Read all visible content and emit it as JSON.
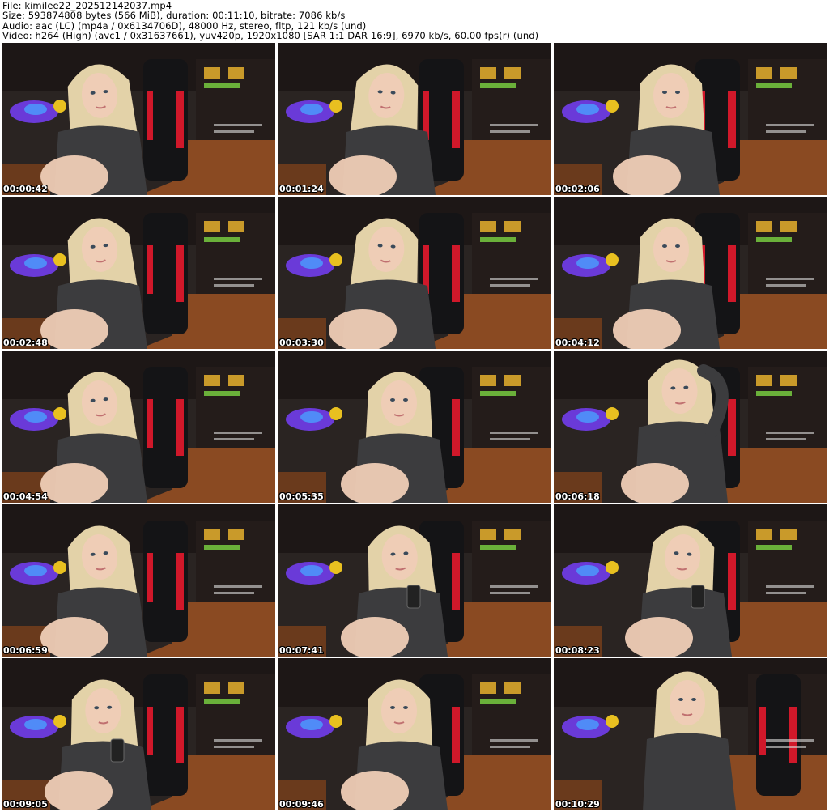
{
  "header": {
    "file_line": "File: kimilee22_202512142037.mp4",
    "size_line": "Size: 593874808 bytes (566 MiB), duration: 00:11:10, bitrate: 7086 kb/s",
    "audio_line": "Audio: aac (LC) (mp4a / 0x6134706D), 48000 Hz, stereo, fltp, 121 kb/s (und)",
    "video_line": "Video: h264 (High) (avc1 / 0x31637661), yuv420p, 1920x1080 [SAR 1:1 DAR 16:9], 6970 kb/s, 60.00 fps(r) (und)"
  },
  "thumbnails": [
    {
      "timestamp": "00:00:42",
      "pose": "left"
    },
    {
      "timestamp": "00:01:24",
      "pose": "side"
    },
    {
      "timestamp": "00:02:06",
      "pose": "right"
    },
    {
      "timestamp": "00:02:48",
      "pose": "left"
    },
    {
      "timestamp": "00:03:30",
      "pose": "side"
    },
    {
      "timestamp": "00:04:12",
      "pose": "right"
    },
    {
      "timestamp": "00:04:54",
      "pose": "left"
    },
    {
      "timestamp": "00:05:35",
      "pose": "center"
    },
    {
      "timestamp": "00:06:18",
      "pose": "arm"
    },
    {
      "timestamp": "00:06:59",
      "pose": "left"
    },
    {
      "timestamp": "00:07:41",
      "pose": "phone"
    },
    {
      "timestamp": "00:08:23",
      "pose": "phone-right"
    },
    {
      "timestamp": "00:09:05",
      "pose": "phone-left"
    },
    {
      "timestamp": "00:09:46",
      "pose": "center"
    },
    {
      "timestamp": "00:10:29",
      "pose": "standing"
    }
  ],
  "colors": {
    "hair": "#e3d2a8",
    "skin": "#efcdb6",
    "sweater": "#3c3c3e",
    "floor": "#8a4a22",
    "wall": "#2a2422",
    "chair_red": "#d0182a",
    "chair_black": "#141416",
    "blob_purple": "#6a3ad8",
    "blob_blue": "#4aa0ff",
    "timestamp": "#ffffff"
  }
}
